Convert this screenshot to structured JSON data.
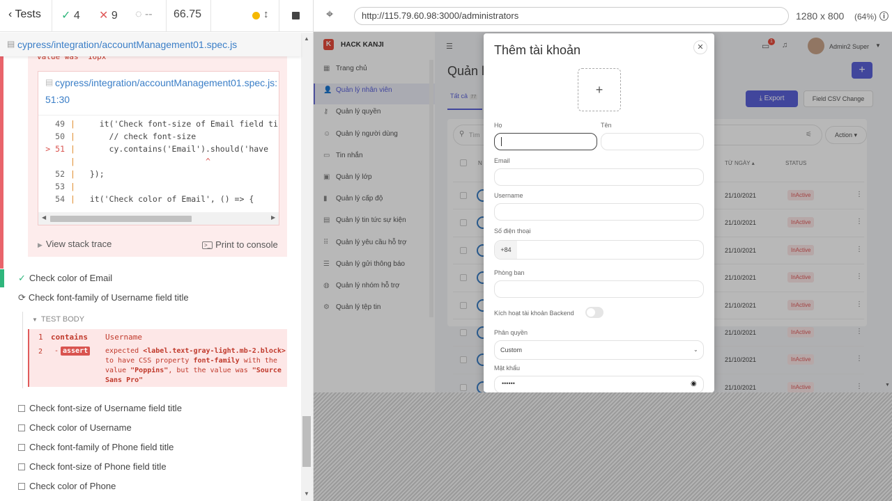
{
  "reporter": {
    "tests_label": "Tests",
    "passed": "4",
    "failed": "9",
    "pending": "--",
    "duration": "66.75",
    "spec_path": "cypress/integration/accountManagement01.spec.js",
    "error_tail": "value was '16px'",
    "code_file": "cypress/integration/accountManagement01.spec.js:",
    "code_loc": "51:30",
    "code_lines": [
      {
        "num": "49",
        "text": "    it('Check font-size of Email field ti"
      },
      {
        "num": "50",
        "text": "      // check font-size"
      },
      {
        "num": "> 51",
        "text": "      cy.contains('Email').should('have"
      },
      {
        "num": "",
        "text": "                          ^"
      },
      {
        "num": "52",
        "text": "  });"
      },
      {
        "num": "53",
        "text": ""
      },
      {
        "num": "54",
        "text": "  it('Check color of Email', () => {"
      }
    ],
    "view_stack": "View stack trace",
    "print_console": "Print to console",
    "test_passed_email_color": "Check color of Email",
    "test_running": "Check font-family of Username field title",
    "test_body": "TEST BODY",
    "cmd1_num": "1",
    "cmd1_name": "contains",
    "cmd1_msg": "Username",
    "cmd2_num": "2",
    "cmd2_name": "assert",
    "cmd2_msg_l1": "expected",
    "cmd2_msg_el": "<label.text-gray-light.mb-2.block>",
    "cmd2_msg_l2a": "to have CSS property",
    "cmd2_msg_l2b": "font-family",
    "cmd2_msg_l2c": "with the",
    "cmd2_msg_l3a": "value",
    "cmd2_msg_l3b": "\"Poppins\"",
    "cmd2_msg_l3c": ", but the value was",
    "cmd2_msg_l3d": "\"Source",
    "cmd2_msg_l4": "Sans Pro\"",
    "pending_tests": [
      "Check font-size of Username field title",
      "Check color of Username",
      "Check font-family of Phone field title",
      "Check font-size of Phone field title",
      "Check color of Phone"
    ]
  },
  "browser": {
    "url": "http://115.79.60.98:3000/administrators",
    "viewport": "1280 x 800",
    "scale": "(64%)"
  },
  "app": {
    "brand": "HACK KANJI",
    "user": "Admin2 Super",
    "notif_count": "1",
    "page_title": "Quản l",
    "tab_all": "Tất cả",
    "tab_count": "77",
    "export": "Export",
    "csv": "Field CSV Change",
    "search_placeholder": "Tìm",
    "action": "Action",
    "col_n": "N",
    "col_date": "TỪ NGÀY",
    "col_status": "STATUS",
    "sidebar": [
      {
        "icon": "grid-icon",
        "glyph": "▦",
        "label": "Trang chủ"
      },
      {
        "icon": "person-icon",
        "glyph": "👤",
        "label": "Quản lý nhân viên"
      },
      {
        "icon": "key-icon",
        "glyph": "⚷",
        "label": "Quản lý quyền"
      },
      {
        "icon": "users-icon",
        "glyph": "☺",
        "label": "Quản lý người dùng"
      },
      {
        "icon": "chat-icon",
        "glyph": "▭",
        "label": "Tin nhắn"
      },
      {
        "icon": "class-icon",
        "glyph": "▣",
        "label": "Quản lý lớp"
      },
      {
        "icon": "bars-icon",
        "glyph": "▮",
        "label": "Quản lý cấp độ"
      },
      {
        "icon": "news-icon",
        "glyph": "▤",
        "label": "Quản lý tin tức sự kiện"
      },
      {
        "icon": "dots-grid-icon",
        "glyph": "⠿",
        "label": "Quản lý yêu cầu hỗ trợ"
      },
      {
        "icon": "sliders-icon",
        "glyph": "☰",
        "label": "Quản lý gửi thông báo"
      },
      {
        "icon": "group-icon",
        "glyph": "◍",
        "label": "Quản lý nhóm hỗ trợ"
      },
      {
        "icon": "settings-icon",
        "glyph": "⚙",
        "label": "Quản lý tệp tin"
      }
    ],
    "rows": [
      {
        "date": "21/10/2021",
        "status": "InActive"
      },
      {
        "date": "21/10/2021",
        "status": "InActive"
      },
      {
        "date": "21/10/2021",
        "status": "InActive"
      },
      {
        "date": "21/10/2021",
        "status": "InActive"
      },
      {
        "date": "21/10/2021",
        "status": "InActive"
      },
      {
        "date": "21/10/2021",
        "status": "InActive"
      },
      {
        "date": "21/10/2021",
        "status": "InActive"
      },
      {
        "date": "21/10/2021",
        "status": "InActive"
      }
    ]
  },
  "modal": {
    "title": "Thêm tài khoản",
    "lbl_ho": "Họ",
    "lbl_ten": "Tên",
    "lbl_email": "Email",
    "lbl_username": "Username",
    "lbl_phone": "Số điện thoại",
    "phone_prefix": "+84",
    "lbl_dept": "Phòng ban",
    "lbl_backend": "Kích hoạt tài khoản Backend",
    "lbl_role": "Phân quyền",
    "role_value": "Custom",
    "lbl_password": "Mật khẩu",
    "password_value": "••••••"
  }
}
